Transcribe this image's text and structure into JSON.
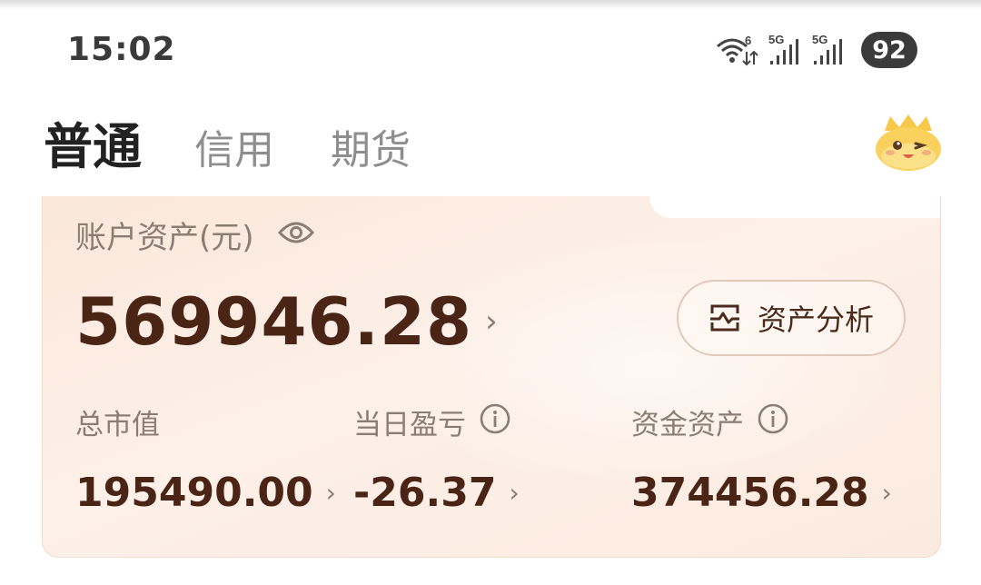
{
  "status_bar": {
    "time": "15:02",
    "battery": "92",
    "wifi_label": "6",
    "signal1_label": "5G",
    "signal2_label": "5G"
  },
  "tabs": [
    {
      "label": "普通",
      "active": true
    },
    {
      "label": "信用",
      "active": false
    },
    {
      "label": "期货",
      "active": false
    }
  ],
  "account": {
    "label": "账户资产(元)",
    "total": "569946.28",
    "analysis_button": "资产分析",
    "metrics": [
      {
        "label": "总市值",
        "value": "195490.00",
        "has_info": false
      },
      {
        "label": "当日盈亏",
        "value": "-26.37",
        "has_info": true
      },
      {
        "label": "资金资产",
        "value": "374456.28",
        "has_info": true
      }
    ]
  },
  "colors": {
    "value_text": "#4a2414",
    "label_text": "#8a7d74",
    "card_bg": "#fbe7db"
  }
}
